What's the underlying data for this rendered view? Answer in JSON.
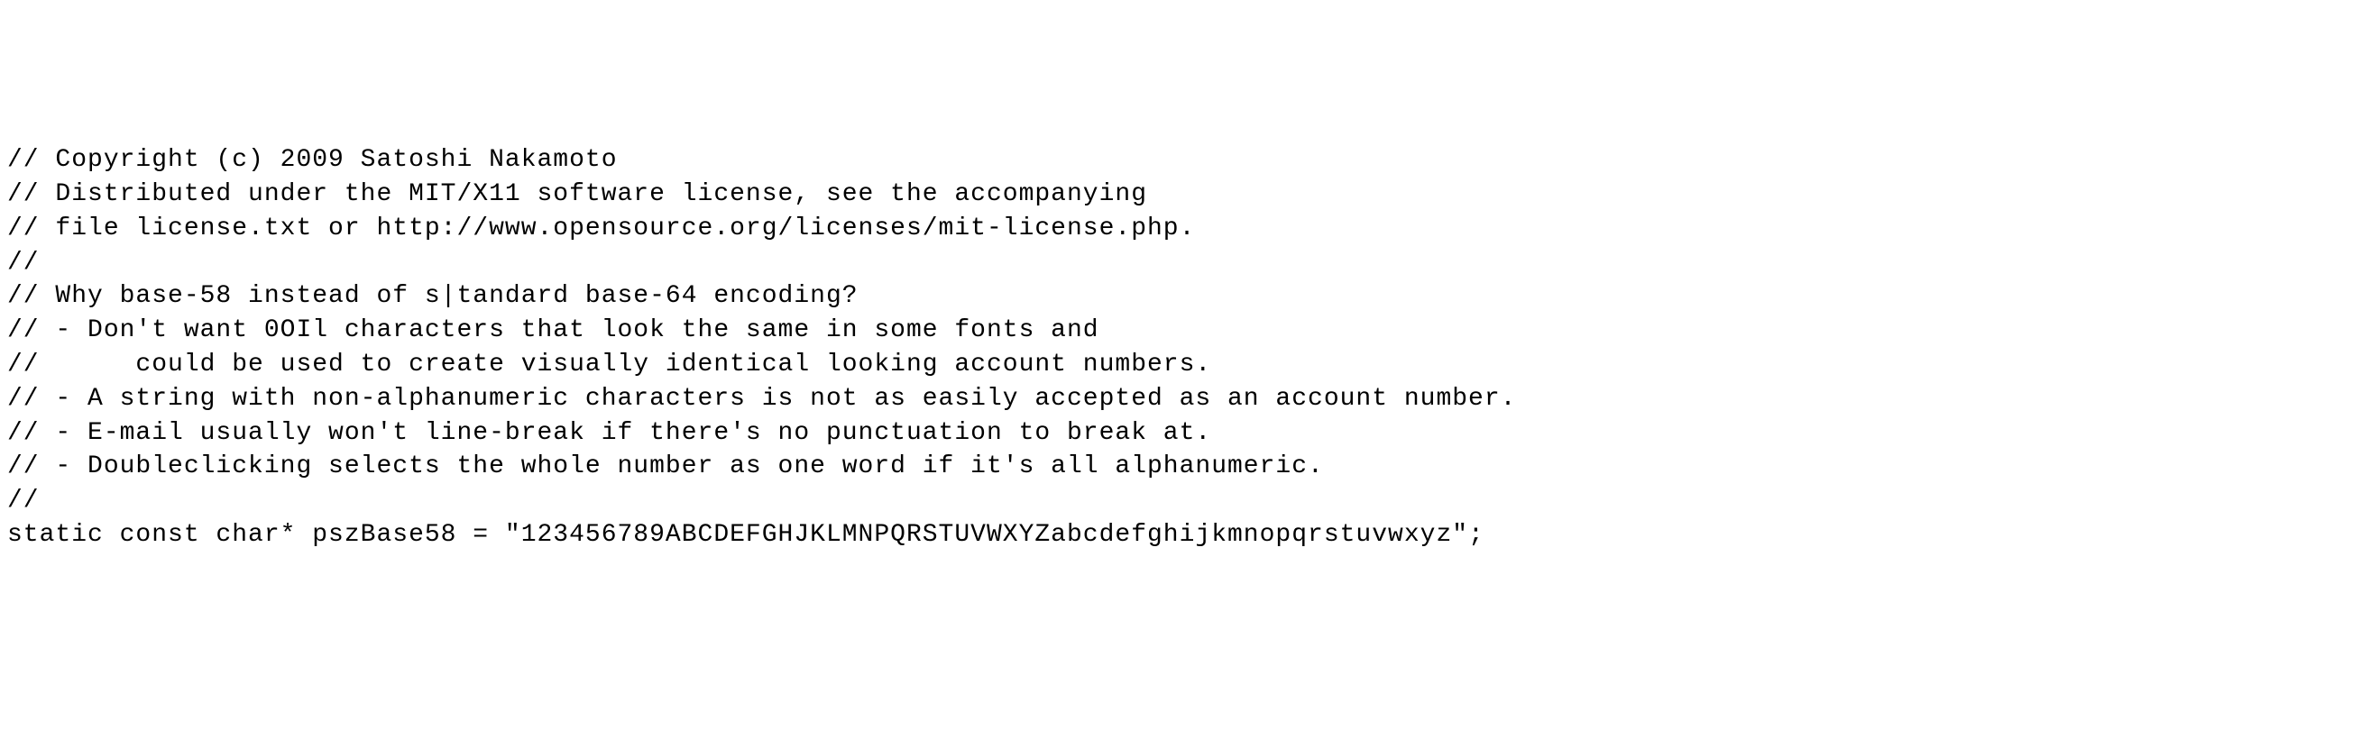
{
  "code": {
    "lines": [
      "// Copyright (c) 2009 Satoshi Nakamoto",
      "// Distributed under the MIT/X11 software license, see the accompanying",
      "// file license.txt or http://www.opensource.org/licenses/mit-license.php.",
      "",
      "",
      "//",
      "// Why base-58 instead of s|tandard base-64 encoding?",
      "// - Don't want 0OIl characters that look the same in some fonts and",
      "//      could be used to create visually identical looking account numbers.",
      "// - A string with non-alphanumeric characters is not as easily accepted as an account number.",
      "// - E-mail usually won't line-break if there's no punctuation to break at.",
      "// - Doubleclicking selects the whole number as one word if it's all alphanumeric.",
      "//",
      "",
      "",
      "static const char* pszBase58 = \"123456789ABCDEFGHJKLMNPQRSTUVWXYZabcdefghijkmnopqrstuvwxyz\";"
    ]
  }
}
